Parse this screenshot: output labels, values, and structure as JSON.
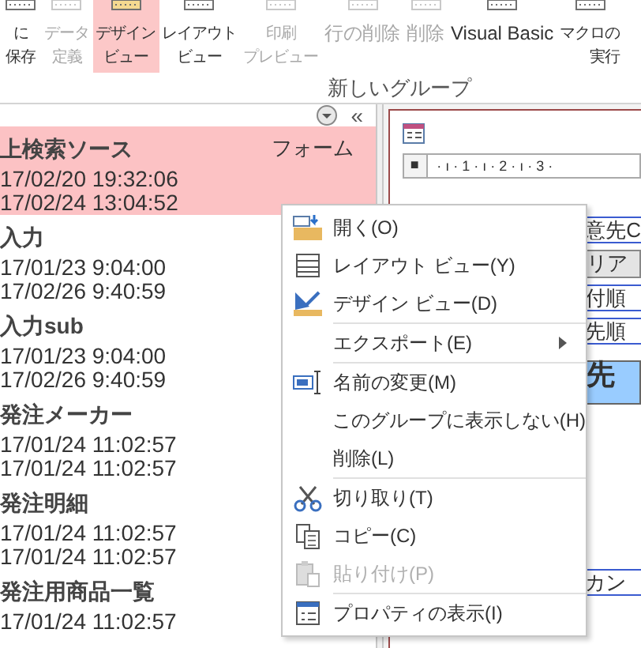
{
  "ribbon": {
    "buttons": [
      {
        "lines": [
          "に",
          "保存"
        ],
        "disabled": false,
        "selected": false
      },
      {
        "lines": [
          "データ",
          "定義"
        ],
        "disabled": true,
        "selected": false
      },
      {
        "lines": [
          "デザイン",
          "ビュー"
        ],
        "disabled": false,
        "selected": true
      },
      {
        "lines": [
          "レイアウト",
          "ビュー"
        ],
        "disabled": false,
        "selected": false
      },
      {
        "lines": [
          "印刷",
          "プレビュー"
        ],
        "disabled": true,
        "selected": false
      },
      {
        "lines": [
          "行の削除"
        ],
        "disabled": true,
        "selected": false
      },
      {
        "lines": [
          "削除"
        ],
        "disabled": true,
        "selected": false
      },
      {
        "lines": [
          "Visual Basic"
        ],
        "disabled": false,
        "selected": false
      },
      {
        "lines": [
          "マクロの",
          "実行"
        ],
        "disabled": false,
        "selected": false
      }
    ],
    "group_label": "新しいグループ"
  },
  "nav_pane": {
    "collapse": "«",
    "items": [
      {
        "name": "上検索ソース",
        "type": "フォーム",
        "created": "17/02/20 19:32:06",
        "modified": "17/02/24 13:04:52",
        "selected": true
      },
      {
        "name": "入力",
        "created": "17/01/23 9:04:00",
        "modified": "17/02/26 9:40:59",
        "selected": false
      },
      {
        "name": "入力sub",
        "created": "17/01/23 9:04:00",
        "modified": "17/02/26 9:40:59",
        "selected": false
      },
      {
        "name": "発注メーカー",
        "created": "17/01/24 11:02:57",
        "modified": "17/01/24 11:02:57",
        "selected": false
      },
      {
        "name": "発注明細",
        "created": "17/01/24 11:02:57",
        "modified": "17/01/24 11:02:57",
        "selected": false
      },
      {
        "name": "発注用商品一覧",
        "created": "17/01/24 11:02:57",
        "selected": false
      }
    ]
  },
  "design": {
    "select_mark": "■",
    "ruler": "· ı · 1 · ı · 2 · ı · 3 ·",
    "cells": [
      {
        "text": "意先C",
        "kind": "label"
      },
      {
        "text": "リア",
        "kind": "field"
      },
      {
        "text": "付順",
        "kind": "label"
      },
      {
        "text": "先順",
        "kind": "label"
      },
      {
        "text": "先",
        "kind": "button"
      },
      {
        "text": "カン",
        "kind": "label"
      }
    ]
  },
  "context_menu": {
    "groups": [
      [
        {
          "label": "開く(O)",
          "disabled": false
        },
        {
          "label": "レイアウト ビュー(Y)",
          "disabled": false
        },
        {
          "label": "デザイン ビュー(D)",
          "disabled": false
        }
      ],
      [
        {
          "label": "エクスポート(E)",
          "disabled": false,
          "submenu": true
        }
      ],
      [
        {
          "label": "名前の変更(M)",
          "disabled": false
        },
        {
          "label": "このグループに表示しない(H)",
          "disabled": false
        },
        {
          "label": "削除(L)",
          "disabled": false
        }
      ],
      [
        {
          "label": "切り取り(T)",
          "disabled": false
        },
        {
          "label": "コピー(C)",
          "disabled": false
        },
        {
          "label": "貼り付け(P)",
          "disabled": true
        }
      ],
      [
        {
          "label": "プロパティの表示(I)",
          "disabled": false
        }
      ]
    ]
  }
}
